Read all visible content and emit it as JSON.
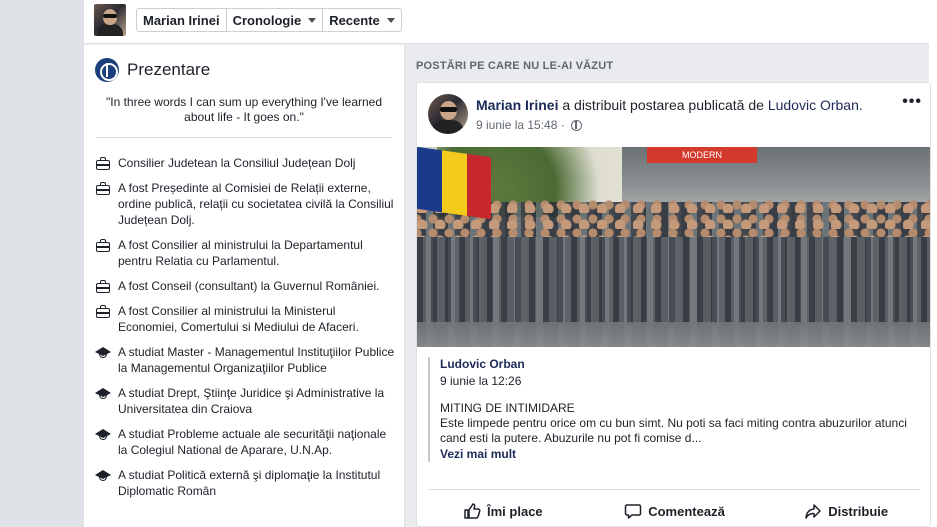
{
  "topbar": {
    "profile_name": "Marian Irinei",
    "tabs": [
      {
        "label": "Cronologie"
      },
      {
        "label": "Recente"
      }
    ]
  },
  "intro": {
    "title": "Prezentare",
    "bio": "\"In three words I can sum up everything I've learned about life - It goes on.\"",
    "facts": [
      {
        "type": "work",
        "prefix": "Consilier Judetean la ",
        "link": "Consiliul Județean Dolj"
      },
      {
        "type": "work",
        "prefix": "A fost Președinte al Comisiei de Relații externe, ordine publică, relații cu societatea civilă la ",
        "link": "Consiliul Județean Dolj."
      },
      {
        "type": "work",
        "prefix": "A fost Consilier al ministrului la ",
        "link": "Departamentul pentru Relatia cu Parlamentul."
      },
      {
        "type": "work",
        "prefix": "A fost Conseil (consultant) la ",
        "link": "Guvernul României."
      },
      {
        "type": "work",
        "prefix": "A fost Consilier al ministrului la ",
        "link": "Ministerul Economiei, Comertului si Mediului de Afaceri."
      },
      {
        "type": "edu",
        "prefix": "A studiat Master - Managementul Instituţiilor Publice la ",
        "link": "Managementul Organizaţiilor Publice"
      },
      {
        "type": "edu",
        "prefix": "A studiat Drept, Ştiinţe Juridice şi Administrative la ",
        "link": "Universitatea din Craiova"
      },
      {
        "type": "edu",
        "prefix": "A studiat Probleme actuale ale securităţii naţionale la ",
        "link": "Colegiul National de Aparare, U.N.Ap."
      },
      {
        "type": "edu",
        "prefix": "A studiat Politică externă şi diplomaţie la ",
        "link": "Institutul Diplomatic Român"
      }
    ]
  },
  "feed": {
    "section_title": "POSTĂRI PE CARE NU LE-AI VĂZUT",
    "post": {
      "author": "Marian Irinei",
      "action_text": " a distribuit postarea publicată de ",
      "shared_from": "Ludovic Orban.",
      "timestamp": "9 iunie la 15:48 ·",
      "more": "•••",
      "photo_sign": "MODERN",
      "shared": {
        "name": "Ludovic Orban",
        "time": "9 iunie la 12:26",
        "title": "MITING DE INTIMIDARE",
        "body": "Este limpede pentru orice om cu bun simt. Nu poti sa faci miting contra abuzurilor atunci cand esti la putere. Abuzurile nu pot fi comise d...",
        "see_more": "Vezi mai mult"
      },
      "actions": {
        "like": "Îmi place",
        "comment": "Comentează",
        "share": "Distribuie"
      }
    }
  },
  "colors": {
    "link": "#1d2a58",
    "background": "#e9ebee"
  }
}
